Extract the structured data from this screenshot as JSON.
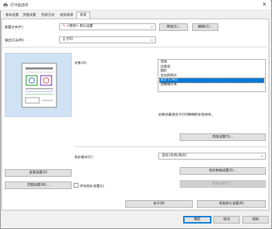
{
  "window": {
    "title": "打印首选项",
    "close_glyph": "✕"
  },
  "tabs": [
    {
      "label": "基本设置"
    },
    {
      "label": "页面设置"
    },
    {
      "label": "完成方式"
    },
    {
      "label": "纸张来源"
    },
    {
      "label": "质量"
    }
  ],
  "profile": {
    "label": "配置文件(F):",
    "value": "<更改> 默认设置",
    "add_label": "添加(1)...",
    "edit_label": "编辑(2)..."
  },
  "output": {
    "label": "输出方法(M):",
    "value": "打印"
  },
  "objective": {
    "label": "对象(O):",
    "items": [
      "常规",
      "出版品",
      "图形",
      "生动的照片",
      "设计 [CAD]",
      "高精细文本"
    ],
    "selected_index": 4,
    "description": "此模式最适合于打印精细的彩色线条。"
  },
  "advanced_label": "高级设置(S)...",
  "color_mode": {
    "label": "色彩模式(C):",
    "value": "自动 [彩色/黑白]"
  },
  "color_detail_label": "色彩数据设置(0)...",
  "color_settings_label": "色彩设置(T)...",
  "view_settings_label": "查看设置(V)",
  "layout_settings_label": "页面设置(W)...",
  "manual_color_label": "手动色彩设置(L)",
  "about_label": "关于(B)",
  "restore_label": "恢复默认设置(R)",
  "ok_label": "确定",
  "cancel_label": "取消",
  "help_label": "帮助",
  "colors": {
    "accent": "#0078d7",
    "preview_bg": "#cfe3f4"
  }
}
